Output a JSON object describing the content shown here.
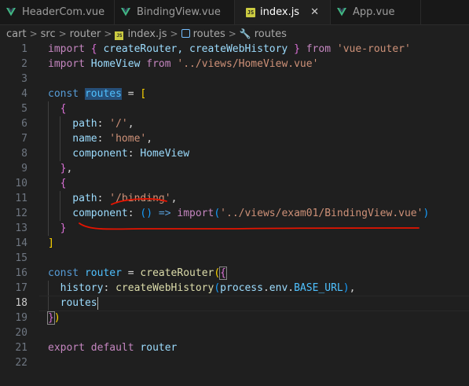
{
  "tabs": [
    {
      "label": "HeaderCom.vue",
      "kind": "vue",
      "active": false
    },
    {
      "label": "BindingView.vue",
      "kind": "vue",
      "active": false
    },
    {
      "label": "index.js",
      "kind": "js",
      "active": true
    },
    {
      "label": "App.vue",
      "kind": "vue",
      "active": false
    }
  ],
  "close_glyph": "✕",
  "js_badge": "JS",
  "breadcrumb": [
    "cart",
    "src",
    "router",
    "index.js",
    "routes",
    "routes"
  ],
  "breadcrumb_sep": ">",
  "current_line": 18,
  "colors": {
    "keyword": "#569cd6",
    "control_keyword": "#c586c0",
    "string": "#ce9178",
    "function": "#dcdcaa",
    "variable": "#9cdcfe",
    "constant": "#4fc1ff",
    "vue_icon": "#41b883",
    "js_icon": "#cbcb41",
    "annotation": "#e51400"
  },
  "code_lines": [
    {
      "n": "1",
      "tokens": [
        {
          "t": "import",
          "c": "kw"
        },
        {
          "t": " ",
          "c": "t"
        },
        {
          "t": "{",
          "c": "b2"
        },
        {
          "t": " createRouter, createWebHistory ",
          "c": "v"
        },
        {
          "t": "}",
          "c": "b2"
        },
        {
          "t": " ",
          "c": "t"
        },
        {
          "t": "from",
          "c": "kw"
        },
        {
          "t": " ",
          "c": "t"
        },
        {
          "t": "'vue-router'",
          "c": "s"
        }
      ]
    },
    {
      "n": "2",
      "tokens": [
        {
          "t": "import",
          "c": "kw"
        },
        {
          "t": " HomeView ",
          "c": "v"
        },
        {
          "t": "from",
          "c": "kw"
        },
        {
          "t": " ",
          "c": "t"
        },
        {
          "t": "'../views/HomeView.vue'",
          "c": "s"
        }
      ]
    },
    {
      "n": "3",
      "tokens": []
    },
    {
      "n": "4",
      "tokens": [
        {
          "t": "const",
          "c": "k"
        },
        {
          "t": " ",
          "c": "t"
        },
        {
          "t": "routes",
          "c": "c",
          "h": "hl"
        },
        {
          "t": " = ",
          "c": "t"
        },
        {
          "t": "[",
          "c": "b1"
        }
      ]
    },
    {
      "n": "5",
      "tokens": [
        {
          "t": "  ",
          "c": "t"
        },
        {
          "t": "{",
          "c": "b2"
        }
      ]
    },
    {
      "n": "6",
      "tokens": [
        {
          "t": "    path",
          "c": "v"
        },
        {
          "t": ": ",
          "c": "t"
        },
        {
          "t": "'/'",
          "c": "s"
        },
        {
          "t": ",",
          "c": "t"
        }
      ]
    },
    {
      "n": "7",
      "tokens": [
        {
          "t": "    name",
          "c": "v"
        },
        {
          "t": ": ",
          "c": "t"
        },
        {
          "t": "'home'",
          "c": "s"
        },
        {
          "t": ",",
          "c": "t"
        }
      ]
    },
    {
      "n": "8",
      "tokens": [
        {
          "t": "    component",
          "c": "v"
        },
        {
          "t": ": ",
          "c": "t"
        },
        {
          "t": "HomeView",
          "c": "v"
        }
      ]
    },
    {
      "n": "9",
      "tokens": [
        {
          "t": "  ",
          "c": "t"
        },
        {
          "t": "}",
          "c": "b2"
        },
        {
          "t": ",",
          "c": "t"
        }
      ]
    },
    {
      "n": "10",
      "tokens": [
        {
          "t": "  ",
          "c": "t"
        },
        {
          "t": "{",
          "c": "b2"
        }
      ]
    },
    {
      "n": "11",
      "tokens": [
        {
          "t": "    path",
          "c": "v"
        },
        {
          "t": ": ",
          "c": "t"
        },
        {
          "t": "'/binding'",
          "c": "s"
        },
        {
          "t": ",",
          "c": "t"
        }
      ]
    },
    {
      "n": "12",
      "tokens": [
        {
          "t": "    component",
          "c": "v"
        },
        {
          "t": ": ",
          "c": "t"
        },
        {
          "t": "()",
          "c": "b3"
        },
        {
          "t": " ",
          "c": "t"
        },
        {
          "t": "=>",
          "c": "k"
        },
        {
          "t": " ",
          "c": "t"
        },
        {
          "t": "import",
          "c": "kw"
        },
        {
          "t": "(",
          "c": "b3"
        },
        {
          "t": "'../views/exam01/BindingView.vue'",
          "c": "s"
        },
        {
          "t": ")",
          "c": "b3"
        }
      ]
    },
    {
      "n": "13",
      "tokens": [
        {
          "t": "  ",
          "c": "t"
        },
        {
          "t": "}",
          "c": "b2"
        }
      ]
    },
    {
      "n": "14",
      "tokens": [
        {
          "t": "]",
          "c": "b1"
        }
      ]
    },
    {
      "n": "15",
      "tokens": []
    },
    {
      "n": "16",
      "tokens": [
        {
          "t": "const",
          "c": "k"
        },
        {
          "t": " ",
          "c": "t"
        },
        {
          "t": "router",
          "c": "c"
        },
        {
          "t": " = ",
          "c": "t"
        },
        {
          "t": "createRouter",
          "c": "f"
        },
        {
          "t": "(",
          "c": "b1"
        },
        {
          "t": "{",
          "c": "b2",
          "h": "bm"
        }
      ]
    },
    {
      "n": "17",
      "tokens": [
        {
          "t": "  history",
          "c": "v"
        },
        {
          "t": ": ",
          "c": "t"
        },
        {
          "t": "createWebHistory",
          "c": "f"
        },
        {
          "t": "(",
          "c": "b3"
        },
        {
          "t": "process",
          "c": "v"
        },
        {
          "t": ".",
          "c": "t"
        },
        {
          "t": "env",
          "c": "v"
        },
        {
          "t": ".",
          "c": "t"
        },
        {
          "t": "BASE_URL",
          "c": "c"
        },
        {
          "t": ")",
          "c": "b3"
        },
        {
          "t": ",",
          "c": "t"
        }
      ]
    },
    {
      "n": "18",
      "tokens": [
        {
          "t": "  routes",
          "c": "v"
        },
        {
          "t": "",
          "c": "cursor"
        }
      ]
    },
    {
      "n": "19",
      "tokens": [
        {
          "t": "}",
          "c": "b2",
          "h": "bm"
        },
        {
          "t": ")",
          "c": "b1"
        }
      ]
    },
    {
      "n": "20",
      "tokens": []
    },
    {
      "n": "21",
      "tokens": [
        {
          "t": "export",
          "c": "kw"
        },
        {
          "t": " ",
          "c": "t"
        },
        {
          "t": "default",
          "c": "kw"
        },
        {
          "t": " router",
          "c": "v"
        }
      ]
    },
    {
      "n": "22",
      "tokens": []
    }
  ]
}
